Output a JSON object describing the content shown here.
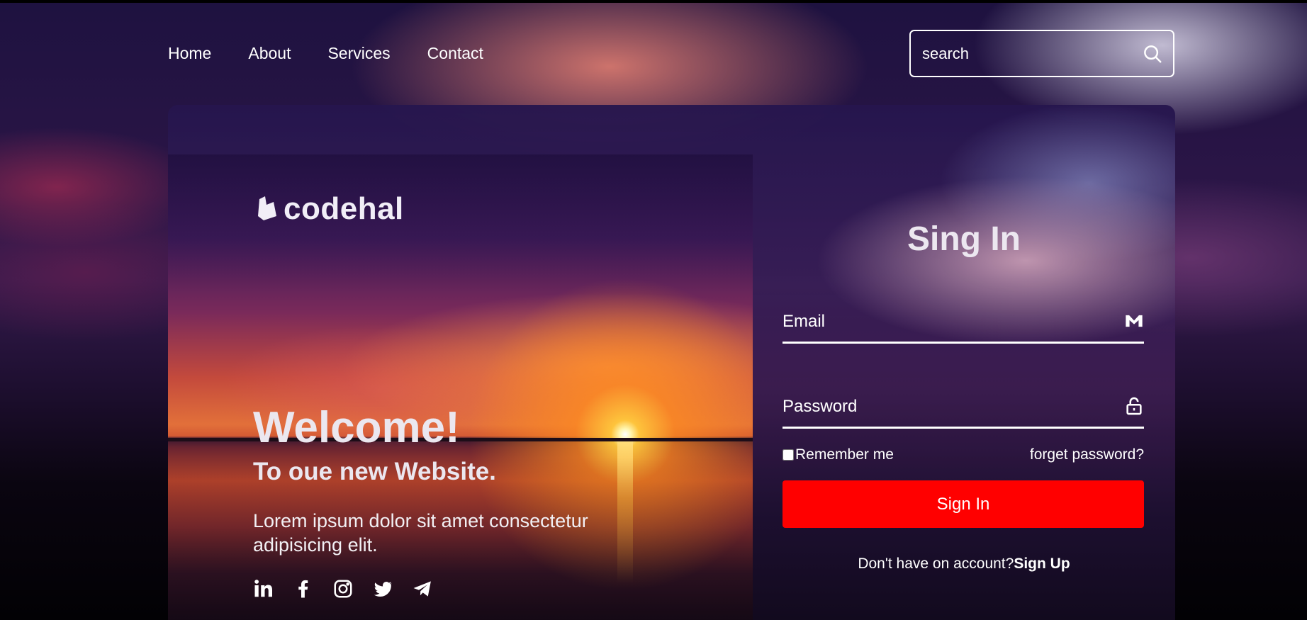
{
  "nav": {
    "items": [
      {
        "label": "Home"
      },
      {
        "label": "About"
      },
      {
        "label": "Services"
      },
      {
        "label": "Contact"
      }
    ]
  },
  "search": {
    "placeholder": "search",
    "value": "",
    "icon": "search-icon"
  },
  "brand": {
    "name": "codehal",
    "icon": "logo-icon"
  },
  "hero": {
    "title": "Welcome!",
    "subtitle": "To oue new Website.",
    "description": "Lorem ipsum dolor sit amet consectetur adipisicing elit.",
    "social": [
      {
        "icon": "linkedin-icon"
      },
      {
        "icon": "facebook-icon"
      },
      {
        "icon": "instagram-icon"
      },
      {
        "icon": "twitter-icon"
      },
      {
        "icon": "telegram-icon"
      }
    ]
  },
  "signin": {
    "title": "Sing In",
    "email_placeholder": "Email",
    "email_icon": "mail-icon",
    "password_placeholder": "Password",
    "password_icon": "lock-icon",
    "remember_label": "Remember me",
    "remember_checked": false,
    "forgot_label": "forget password?",
    "button_label": "Sign In",
    "button_color": "#ff0000",
    "signup_prompt": "Don't have on account?",
    "signup_link": "Sign Up"
  }
}
